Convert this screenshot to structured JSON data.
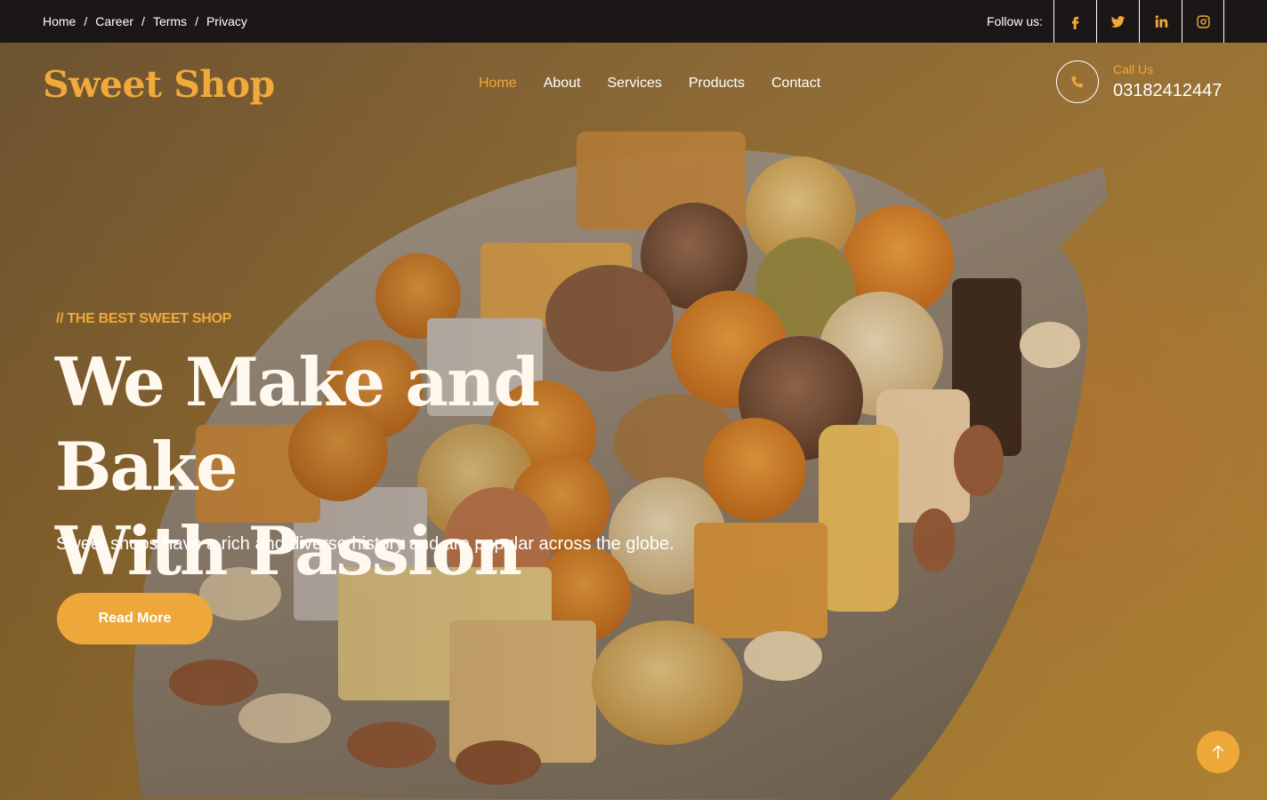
{
  "topbar": {
    "breadcrumbs": [
      {
        "label": "Home"
      },
      {
        "label": "Career"
      },
      {
        "label": "Terms"
      },
      {
        "label": "Privacy"
      }
    ],
    "separator": "/",
    "follow_label": "Follow us:",
    "social": [
      {
        "icon": "facebook-icon"
      },
      {
        "icon": "twitter-icon"
      },
      {
        "icon": "linkedin-icon"
      },
      {
        "icon": "instagram-icon"
      }
    ]
  },
  "header": {
    "logo": "Sweet Shop",
    "nav": [
      {
        "label": "Home",
        "active": true
      },
      {
        "label": "About"
      },
      {
        "label": "Services"
      },
      {
        "label": "Products"
      },
      {
        "label": "Contact"
      }
    ],
    "call_label": "Call Us",
    "call_number": "03182412447",
    "call_icon": "phone-icon"
  },
  "hero": {
    "eyebrow": "// THE BEST SWEET SHOP",
    "headline_line1": "We Make and Bake",
    "headline_line2": "With Passion",
    "subtext": "Sweet shops have a rich and diverse history and are popular across the globe.",
    "cta_label": "Read More",
    "scroll_top_icon": "arrow-up-icon"
  },
  "colors": {
    "accent": "#f0a93a",
    "topbar_bg": "#1b1716",
    "button": "#eda839"
  }
}
